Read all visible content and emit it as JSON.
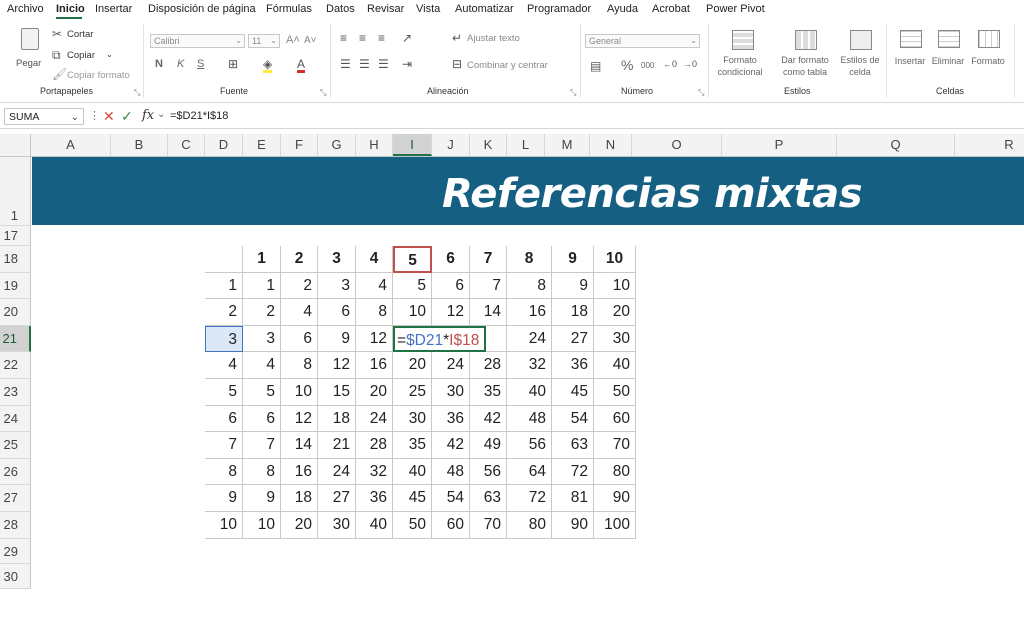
{
  "menu": {
    "tabs": [
      "Archivo",
      "Inicio",
      "Insertar",
      "Disposición de página",
      "Fórmulas",
      "Datos",
      "Revisar",
      "Vista",
      "Automatizar",
      "Programador",
      "Ayuda",
      "Acrobat",
      "Power Pivot"
    ],
    "active": "Inicio"
  },
  "ribbon": {
    "clipboard": {
      "paste": "Pegar",
      "cut": "Cortar",
      "copy": "Copiar",
      "format_painter": "Copiar formato",
      "label": "Portapapeles"
    },
    "font": {
      "name": "Calibri",
      "size": "11",
      "bold": "N",
      "italic": "K",
      "underline": "S",
      "label": "Fuente"
    },
    "alignment": {
      "wrap": "Ajustar texto",
      "merge": "Combinar y centrar",
      "label": "Alineación"
    },
    "number": {
      "format": "General",
      "percent": "%",
      "thousands": "000",
      "label": "Número"
    },
    "styles": {
      "conditional": "Formato condicional",
      "as_table": "Dar formato como tabla",
      "cell_styles": "Estilos de celda",
      "label": "Estilos"
    },
    "cells": {
      "insert": "Insertar",
      "delete": "Eliminar",
      "format": "Formato",
      "label": "Celdas"
    }
  },
  "formula_bar": {
    "name_box": "SUMA",
    "fx": "fx",
    "formula": "=$D21*I$18"
  },
  "columns": [
    "A",
    "B",
    "C",
    "D",
    "E",
    "F",
    "G",
    "H",
    "I",
    "J",
    "K",
    "L",
    "M",
    "N",
    "O",
    "P",
    "Q",
    "R"
  ],
  "rows": [
    "1",
    "17",
    "18",
    "19",
    "20",
    "21",
    "22",
    "23",
    "24",
    "25",
    "26",
    "27",
    "28",
    "29",
    "30"
  ],
  "selected_column": "I",
  "selected_row": "21",
  "banner_title": "Referencias mixtas",
  "table": {
    "header": [
      "1",
      "2",
      "3",
      "4",
      "5",
      "6",
      "7",
      "8",
      "9",
      "10"
    ],
    "row_labels": [
      "1",
      "2",
      "3",
      "4",
      "5",
      "6",
      "7",
      "8",
      "9",
      "10"
    ],
    "body": [
      [
        "1",
        "2",
        "3",
        "4",
        "5",
        "6",
        "7",
        "8",
        "9",
        "10"
      ],
      [
        "2",
        "4",
        "6",
        "8",
        "10",
        "12",
        "14",
        "16",
        "18",
        "20"
      ],
      [
        "3",
        "6",
        "9",
        "12",
        "",
        "",
        "",
        "24",
        "27",
        "30"
      ],
      [
        "4",
        "8",
        "12",
        "16",
        "20",
        "24",
        "28",
        "32",
        "36",
        "40"
      ],
      [
        "5",
        "10",
        "15",
        "20",
        "25",
        "30",
        "35",
        "40",
        "45",
        "50"
      ],
      [
        "6",
        "12",
        "18",
        "24",
        "30",
        "36",
        "42",
        "48",
        "54",
        "60"
      ],
      [
        "7",
        "14",
        "21",
        "28",
        "35",
        "42",
        "49",
        "56",
        "63",
        "70"
      ],
      [
        "8",
        "16",
        "24",
        "32",
        "40",
        "48",
        "56",
        "64",
        "72",
        "80"
      ],
      [
        "9",
        "18",
        "27",
        "36",
        "45",
        "54",
        "63",
        "72",
        "81",
        "90"
      ],
      [
        "10",
        "20",
        "30",
        "40",
        "50",
        "60",
        "70",
        "80",
        "90",
        "100"
      ]
    ],
    "edit_cell": {
      "eq": "=",
      "ref_row": "$D21",
      "op": "*",
      "ref_col": "I$18"
    }
  }
}
